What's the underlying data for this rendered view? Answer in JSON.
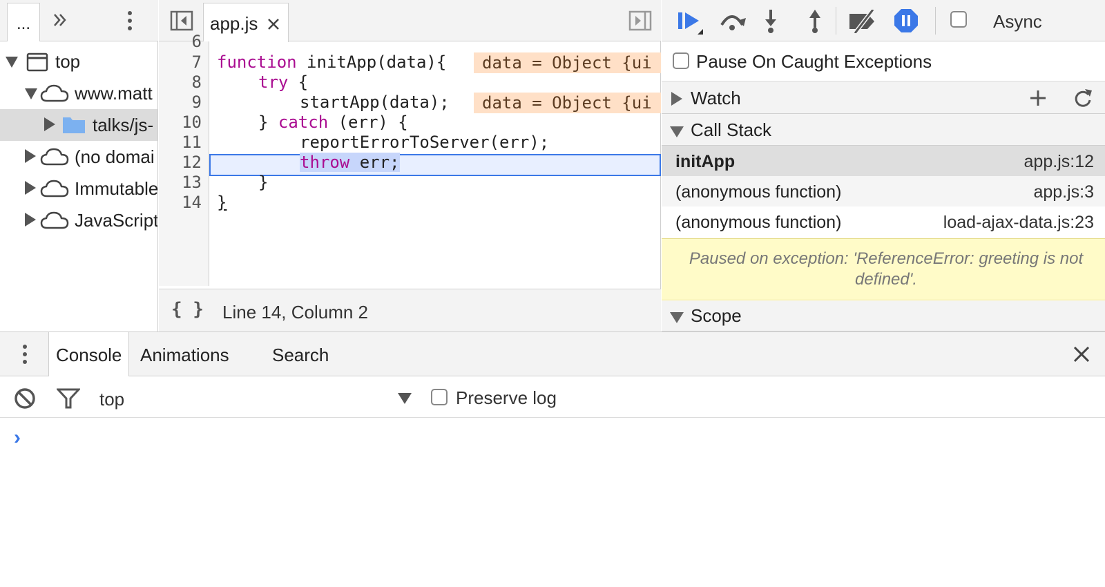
{
  "navigator": {
    "more_tabs_label": "...",
    "tree": [
      {
        "label": "top"
      },
      {
        "label": "www.matt"
      },
      {
        "label": "talks/js-"
      },
      {
        "label": "(no domai"
      },
      {
        "label": "Immutable"
      },
      {
        "label": "JavaScript"
      }
    ]
  },
  "editor": {
    "tab_label": "app.js",
    "line_numbers": [
      "6",
      "7",
      "8",
      "9",
      "10",
      "11",
      "12",
      "13",
      "14"
    ],
    "lines": {
      "l7_kw": "function",
      "l7_rest": " initApp(data){",
      "l8_kw": "try",
      "l8_rest": " {",
      "l9": "startApp(data);",
      "l10_a": "} ",
      "l10_kw": "catch",
      "l10_b": " (err) {",
      "l11": "reportErrorToServer(err);",
      "l12_kw": "throw",
      "l12_rest": " err;",
      "l13": "}",
      "l14": "}"
    },
    "inline_values": [
      "data = Object {ui",
      "data = Object {ui"
    ],
    "format_icon": "{ }",
    "status": "Line 14, Column 2"
  },
  "debugger": {
    "async_label": "Async",
    "pause_caught_label": "Pause On Caught Exceptions",
    "watch_label": "Watch",
    "call_stack_label": "Call Stack",
    "frames": [
      {
        "fn": "initApp",
        "loc": "app.js:12",
        "selected": true
      },
      {
        "fn": "(anonymous function)",
        "loc": "app.js:3"
      },
      {
        "fn": "(anonymous function)",
        "loc": "load-ajax-data.js:23"
      }
    ],
    "exception_message": "Paused on exception: 'ReferenceError: greeting is not defined'.",
    "scope_label": "Scope"
  },
  "drawer": {
    "tabs": [
      "Console",
      "Animations",
      "Search"
    ],
    "context": "top",
    "preserve_log_label": "Preserve log",
    "prompt": "›"
  },
  "colors": {
    "accent": "#3b78e7",
    "keyword": "#aa0d91",
    "inline_value_bg": "#ffe0c7",
    "exception_bg": "#fffbc8"
  }
}
